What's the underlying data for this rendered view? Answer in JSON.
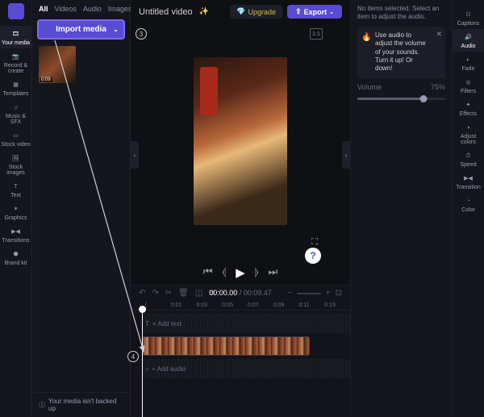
{
  "header": {
    "title": "Untitled video",
    "upgrade": "Upgrade",
    "export": "Export",
    "ratio": "1:1"
  },
  "leftRail": {
    "items": [
      {
        "label": "Your media",
        "icon": "🎞"
      },
      {
        "label": "Record & create",
        "icon": "📷"
      },
      {
        "label": "Templates",
        "icon": "▦"
      },
      {
        "label": "Music & SFX",
        "icon": "♫"
      },
      {
        "label": "Stock video",
        "icon": "▭"
      },
      {
        "label": "Stock images",
        "icon": "🖼"
      },
      {
        "label": "Text",
        "icon": "T"
      },
      {
        "label": "Graphics",
        "icon": "✶"
      },
      {
        "label": "Transitions",
        "icon": "▶◀"
      },
      {
        "label": "Brand kit",
        "icon": "⬢"
      }
    ]
  },
  "mediaPanel": {
    "tabs": [
      "All",
      "Videos",
      "Audio",
      "Images"
    ],
    "import": "Import media",
    "thumbDuration": "0:09",
    "footer": "Your media isn't backed up"
  },
  "transport": {
    "currentTime": "00:00.00",
    "totalTime": "00:09.47"
  },
  "ruler": [
    "|",
    "0:01",
    "0:03",
    "0:05",
    "0:07",
    "0:09",
    "0:11",
    "0:13"
  ],
  "tracks": {
    "text": "+ Add text",
    "audio": "+ Add audio"
  },
  "rightPanel": {
    "empty": "No items selected. Select an item to adjust the audio.",
    "tip": "Use audio to adjust the volume of your sounds. Turn it up! Or down!",
    "volumeLabel": "Volume",
    "volumeValue": "75%"
  },
  "rightRail": {
    "items": [
      {
        "label": "Captions",
        "icon": "☷"
      },
      {
        "label": "Audio",
        "icon": "🔊"
      },
      {
        "label": "Fade",
        "icon": "◐"
      },
      {
        "label": "Filters",
        "icon": "◎"
      },
      {
        "label": "Effects",
        "icon": "✦"
      },
      {
        "label": "Adjust colors",
        "icon": "◑"
      },
      {
        "label": "Speed",
        "icon": "⏱"
      },
      {
        "label": "Transition",
        "icon": "▶◀"
      },
      {
        "label": "Color",
        "icon": "◔"
      }
    ]
  },
  "steps": {
    "s3": "3",
    "s4": "4"
  },
  "help": "?"
}
